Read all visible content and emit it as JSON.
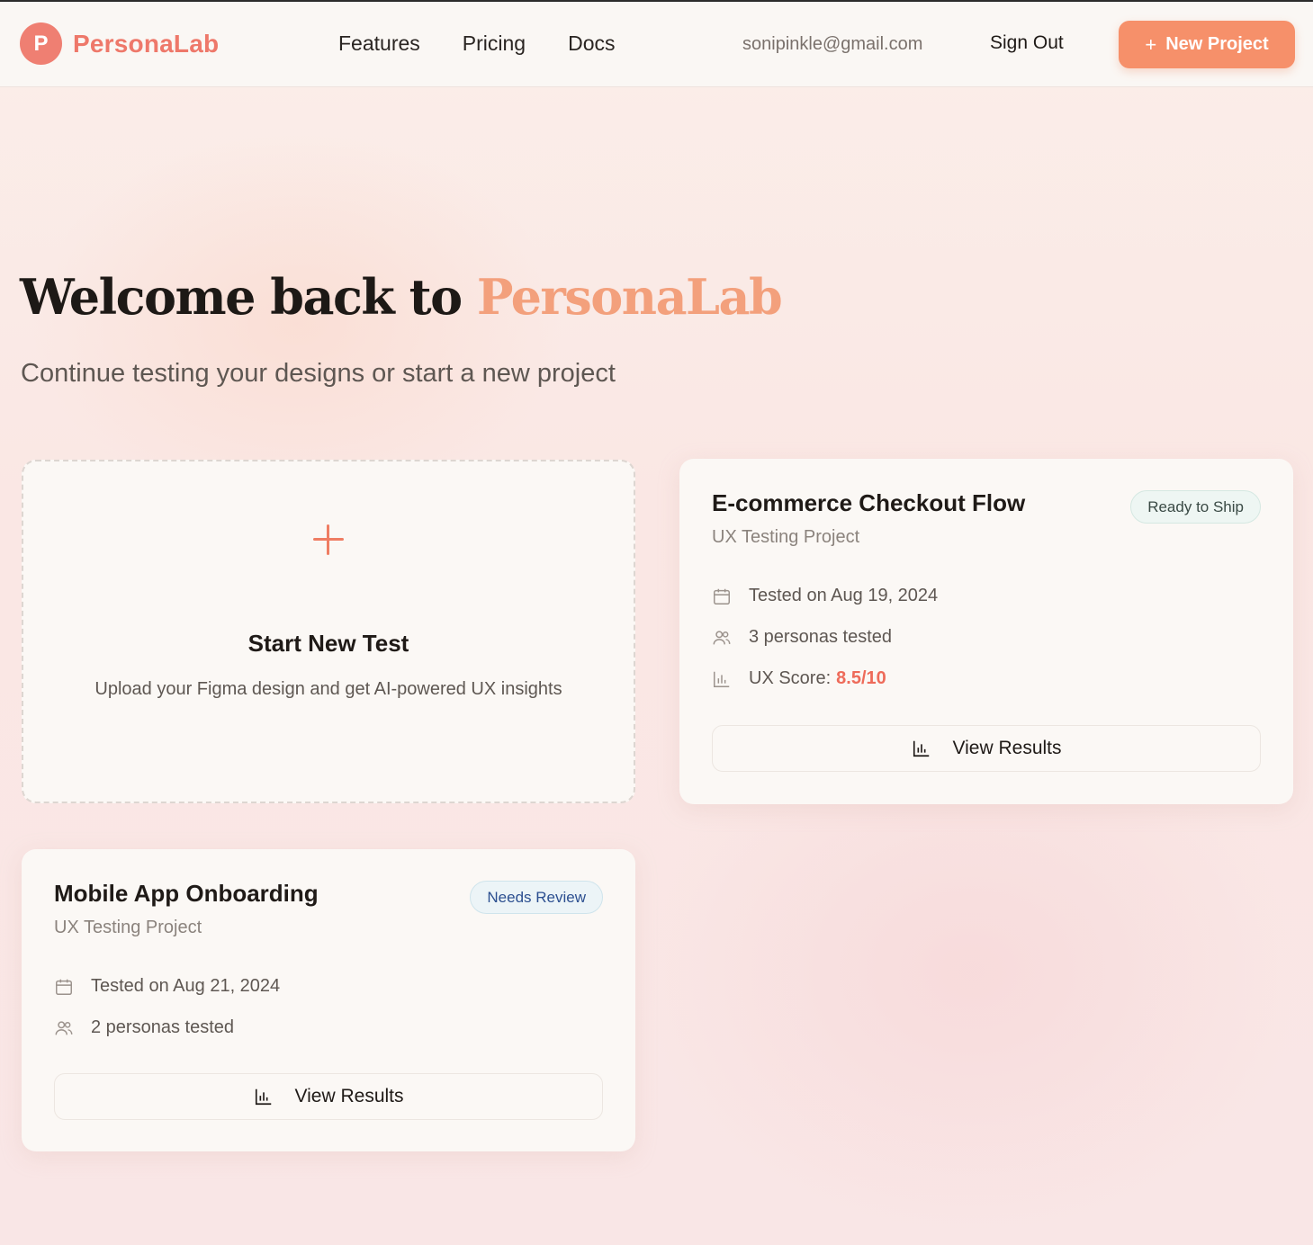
{
  "brand": {
    "logo_letter": "P",
    "name": "PersonaLab",
    "accent": "#ee786a",
    "cta": "#f6906a"
  },
  "nav": {
    "items": [
      "Features",
      "Pricing",
      "Docs"
    ]
  },
  "header": {
    "email": "sonipinkle@gmail.com",
    "sign_out": "Sign Out",
    "new_project": "New Project"
  },
  "hero": {
    "title_prefix": "Welcome back to",
    "title_brand": "PersonaLab",
    "subtitle": "Continue testing your designs or start a new project"
  },
  "new_test": {
    "title": "Start New Test",
    "description": "Upload your Figma design and get AI-powered UX insights"
  },
  "projects": [
    {
      "title": "E-commerce Checkout Flow",
      "subtitle": "UX Testing Project",
      "status": "Ready to Ship",
      "tested": "Tested on Aug 19, 2024",
      "personas": "3 personas tested",
      "score_label": "UX Score:",
      "score_value": "8.5/10",
      "action": "View Results"
    },
    {
      "title": "Mobile App Onboarding",
      "subtitle": "UX Testing Project",
      "status": "Needs Review",
      "tested": "Tested on Aug 21, 2024",
      "personas": "2 personas tested",
      "action": "View Results"
    }
  ],
  "icons": {
    "calendar": "calendar-icon",
    "users": "users-icon",
    "chart": "bar-chart-icon",
    "plus": "plus-icon"
  }
}
